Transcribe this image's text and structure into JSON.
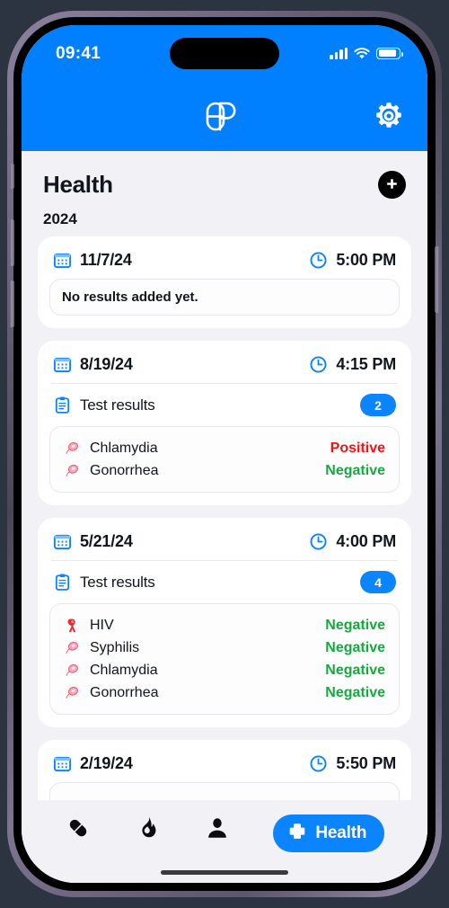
{
  "status_bar": {
    "time": "09:41",
    "signal_icon": "cellular-signal-icon",
    "wifi_icon": "wifi-icon",
    "battery_icon": "battery-icon"
  },
  "app_header": {
    "logo_icon": "pill-p-logo-icon",
    "settings_icon": "gear-icon"
  },
  "theme": {
    "brand_blue": "#0080ff",
    "accent_blue": "#0a84ff",
    "positive_red": "#fb0f0f",
    "negative_green": "#13ab3e",
    "background": "#f1f1f6",
    "card": "#ffffff"
  },
  "page": {
    "title": "Health",
    "add_button_icon": "plus-circle-icon",
    "year_section": "2024"
  },
  "cards": [
    {
      "date": "11/7/24",
      "time": "5:00 PM",
      "calendar_icon": "calendar-icon",
      "clock_icon": "clock-icon",
      "empty_text": "No results added yet.",
      "has_results": false
    },
    {
      "date": "8/19/24",
      "time": "4:15 PM",
      "calendar_icon": "calendar-icon",
      "clock_icon": "clock-icon",
      "has_results": true,
      "results_label": "Test results",
      "results_icon": "clipboard-icon",
      "results_count": "2",
      "results": [
        {
          "icon": "microbe-icon",
          "name": "Chlamydia",
          "value": "Positive",
          "status": "positive"
        },
        {
          "icon": "microbe-icon",
          "name": "Gonorrhea",
          "value": "Negative",
          "status": "negative"
        }
      ]
    },
    {
      "date": "5/21/24",
      "time": "4:00 PM",
      "calendar_icon": "calendar-icon",
      "clock_icon": "clock-icon",
      "has_results": true,
      "results_label": "Test results",
      "results_icon": "clipboard-icon",
      "results_count": "4",
      "results": [
        {
          "icon": "ribbon-icon",
          "name": "HIV",
          "value": "Negative",
          "status": "negative"
        },
        {
          "icon": "microbe-icon",
          "name": "Syphilis",
          "value": "Negative",
          "status": "negative"
        },
        {
          "icon": "microbe-icon",
          "name": "Chlamydia",
          "value": "Negative",
          "status": "negative"
        },
        {
          "icon": "microbe-icon",
          "name": "Gonorrhea",
          "value": "Negative",
          "status": "negative"
        }
      ]
    },
    {
      "date": "2/19/24",
      "time": "5:50 PM",
      "calendar_icon": "calendar-icon",
      "clock_icon": "clock-icon",
      "has_results": false,
      "partial": true
    }
  ],
  "tabbar": {
    "items": [
      {
        "icon": "pill-icon",
        "label": "",
        "active": false
      },
      {
        "icon": "flame-icon",
        "label": "",
        "active": false
      },
      {
        "icon": "person-icon",
        "label": "",
        "active": false
      }
    ],
    "active_tab": {
      "icon": "medical-cross-icon",
      "label": "Health"
    }
  }
}
